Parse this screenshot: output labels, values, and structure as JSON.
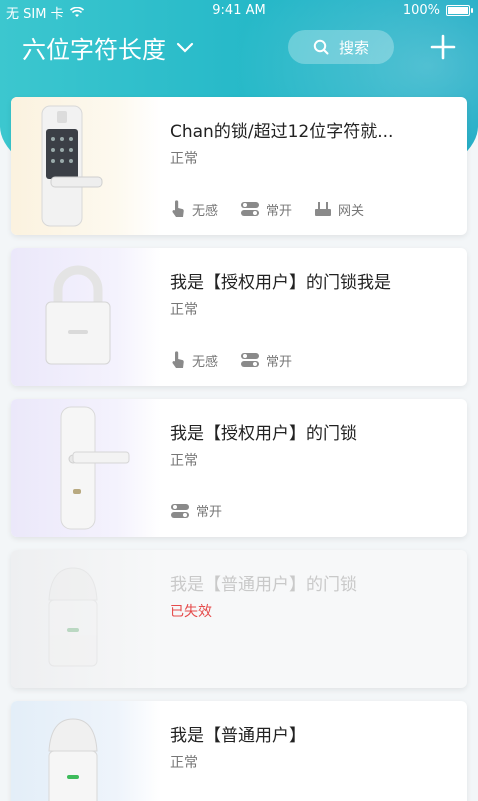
{
  "status_bar": {
    "carrier": "无 SIM 卡",
    "time": "9:41 AM",
    "battery": "100%",
    "battery_level": 1.0
  },
  "header": {
    "title": "六位字符长度",
    "search_label": "搜索"
  },
  "colors": {
    "accent": "#25b8c8",
    "invalid": "#e54b4b"
  },
  "locks": [
    {
      "name": "Chan的锁/超过12位字符就...",
      "status": "正常",
      "icon": "door-handle-lock",
      "features": [
        {
          "label": "无感",
          "icon": "touch-icon"
        },
        {
          "label": "常开",
          "icon": "toggle-icon"
        },
        {
          "label": "网关",
          "icon": "gateway-icon"
        }
      ]
    },
    {
      "name": "我是【授权用户】的门锁我是",
      "status": "正常",
      "icon": "padlock",
      "features": [
        {
          "label": "无感",
          "icon": "touch-icon"
        },
        {
          "label": "常开",
          "icon": "toggle-icon"
        }
      ]
    },
    {
      "name": "我是【授权用户】的门锁",
      "status": "正常",
      "icon": "lever-lock",
      "features": [
        {
          "label": "常开",
          "icon": "toggle-icon"
        }
      ]
    },
    {
      "name": "我是【普通用户】的门锁",
      "status": "已失效",
      "icon": "cabinet-lock",
      "features": []
    },
    {
      "name": "我是【普通用户】",
      "status": "正常",
      "icon": "cabinet-lock",
      "features": []
    }
  ]
}
